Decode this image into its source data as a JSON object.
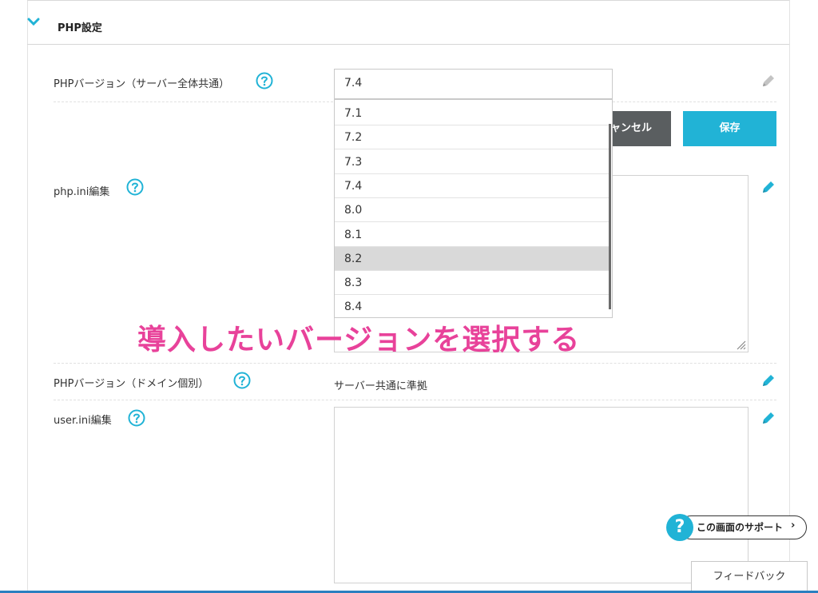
{
  "section": {
    "title": "PHP設定"
  },
  "rows": {
    "php_version_server": {
      "label": "PHPバージョン（サーバー全体共通）",
      "selected_value": "7.4"
    },
    "php_ini": {
      "label": "php.ini編集"
    },
    "php_version_domain": {
      "label": "PHPバージョン（ドメイン個別）",
      "value": "サーバー共通に準拠"
    },
    "user_ini": {
      "label": "user.ini編集"
    }
  },
  "dropdown": {
    "options": [
      "7.1",
      "7.2",
      "7.3",
      "7.4",
      "8.0",
      "8.1",
      "8.2",
      "8.3",
      "8.4"
    ],
    "highlighted": "8.2"
  },
  "buttons": {
    "cancel": "ャンセル",
    "save": "保存"
  },
  "annotation": "導入したいバージョンを選択する",
  "support": {
    "label": "この画面のサポート",
    "q": "?",
    "chevron": "›"
  },
  "feedback": "フィードバック",
  "colors": {
    "accent": "#21b3d6",
    "annotation": "#e8429a",
    "cancel": "#5a5e60"
  }
}
